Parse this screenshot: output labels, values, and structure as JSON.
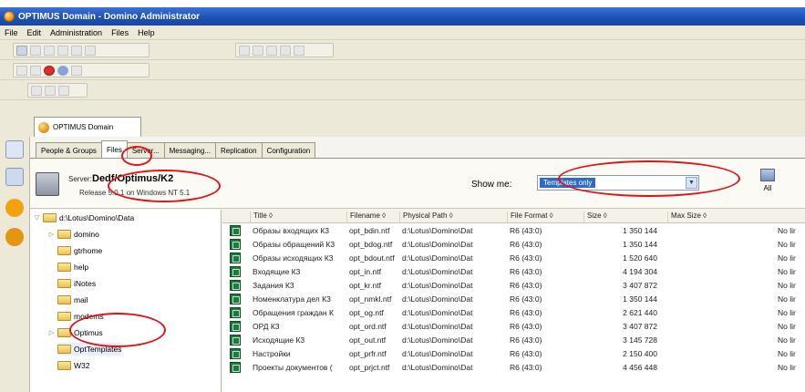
{
  "window": {
    "title": "OPTIMUS Domain - Domino Administrator"
  },
  "menu": {
    "items": [
      "File",
      "Edit",
      "Administration",
      "Files",
      "Help"
    ]
  },
  "doc_tab": {
    "label": "OPTIMUS Domain"
  },
  "tabs": [
    {
      "label": "People & Groups"
    },
    {
      "label": "Files"
    },
    {
      "label": "Server..."
    },
    {
      "label": "Messaging..."
    },
    {
      "label": "Replication"
    },
    {
      "label": "Configuration"
    }
  ],
  "server": {
    "label": "Server:",
    "name": "Dedf/Optimus/K2",
    "release": "Release 5.0.1 on Windows NT 5.1"
  },
  "show_me": {
    "label": "Show me:",
    "value": "Templates only"
  },
  "all_button": {
    "label": "All"
  },
  "tree": {
    "root": "d:\\Lotus\\Domino\\Data",
    "items": [
      "domino",
      "gtrhome",
      "help",
      "iNotes",
      "mail",
      "modems",
      "Optimus",
      "OptTemplates",
      "W32"
    ]
  },
  "table": {
    "columns": [
      "Title",
      "Filename",
      "Physical Path",
      "File Format",
      "Size",
      "Max Size"
    ],
    "rows": [
      {
        "title": "Образы входящих К3",
        "filename": "opt_bdin.ntf",
        "path": "d:\\Lotus\\Domino\\Dat",
        "format": "R6 (43:0)",
        "size": "1 350 144",
        "max": "No lir"
      },
      {
        "title": "Образы обращений К3",
        "filename": "opt_bdog.ntf",
        "path": "d:\\Lotus\\Domino\\Dat",
        "format": "R6 (43:0)",
        "size": "1 350 144",
        "max": "No lir"
      },
      {
        "title": "Образы исходящих К3",
        "filename": "opt_bdout.ntf",
        "path": "d:\\Lotus\\Domino\\Dat",
        "format": "R6 (43:0)",
        "size": "1 520 640",
        "max": "No lir"
      },
      {
        "title": "Входящие К3",
        "filename": "opt_in.ntf",
        "path": "d:\\Lotus\\Domino\\Dat",
        "format": "R6 (43:0)",
        "size": "4 194 304",
        "max": "No lir"
      },
      {
        "title": "Задания К3",
        "filename": "opt_kr.ntf",
        "path": "d:\\Lotus\\Domino\\Dat",
        "format": "R6 (43:0)",
        "size": "3 407 872",
        "max": "No lir"
      },
      {
        "title": "Номенклатура дел К3",
        "filename": "opt_nmkl.ntf",
        "path": "d:\\Lotus\\Domino\\Dat",
        "format": "R6 (43:0)",
        "size": "1 350 144",
        "max": "No lir"
      },
      {
        "title": "Обращения граждан К",
        "filename": "opt_og.ntf",
        "path": "d:\\Lotus\\Domino\\Dat",
        "format": "R6 (43:0)",
        "size": "2 621 440",
        "max": "No lir"
      },
      {
        "title": "ОРД К3",
        "filename": "opt_ord.ntf",
        "path": "d:\\Lotus\\Domino\\Dat",
        "format": "R6 (43:0)",
        "size": "3 407 872",
        "max": "No lir"
      },
      {
        "title": "Исходящие К3",
        "filename": "opt_out.ntf",
        "path": "d:\\Lotus\\Domino\\Dat",
        "format": "R6 (43:0)",
        "size": "3 145 728",
        "max": "No lir"
      },
      {
        "title": "Настройки",
        "filename": "opt_prfr.ntf",
        "path": "d:\\Lotus\\Domino\\Dat",
        "format": "R6 (43:0)",
        "size": "2 150 400",
        "max": "No lir"
      },
      {
        "title": "Проекты документов (",
        "filename": "opt_prjct.ntf",
        "path": "d:\\Lotus\\Domino\\Dat",
        "format": "R6 (43:0)",
        "size": "4 456 448",
        "max": "No lir"
      }
    ]
  },
  "colors": {
    "titlebar": "#1c4fb2",
    "highlight_oval": "#e01414",
    "chrome": "#ece9d8"
  }
}
